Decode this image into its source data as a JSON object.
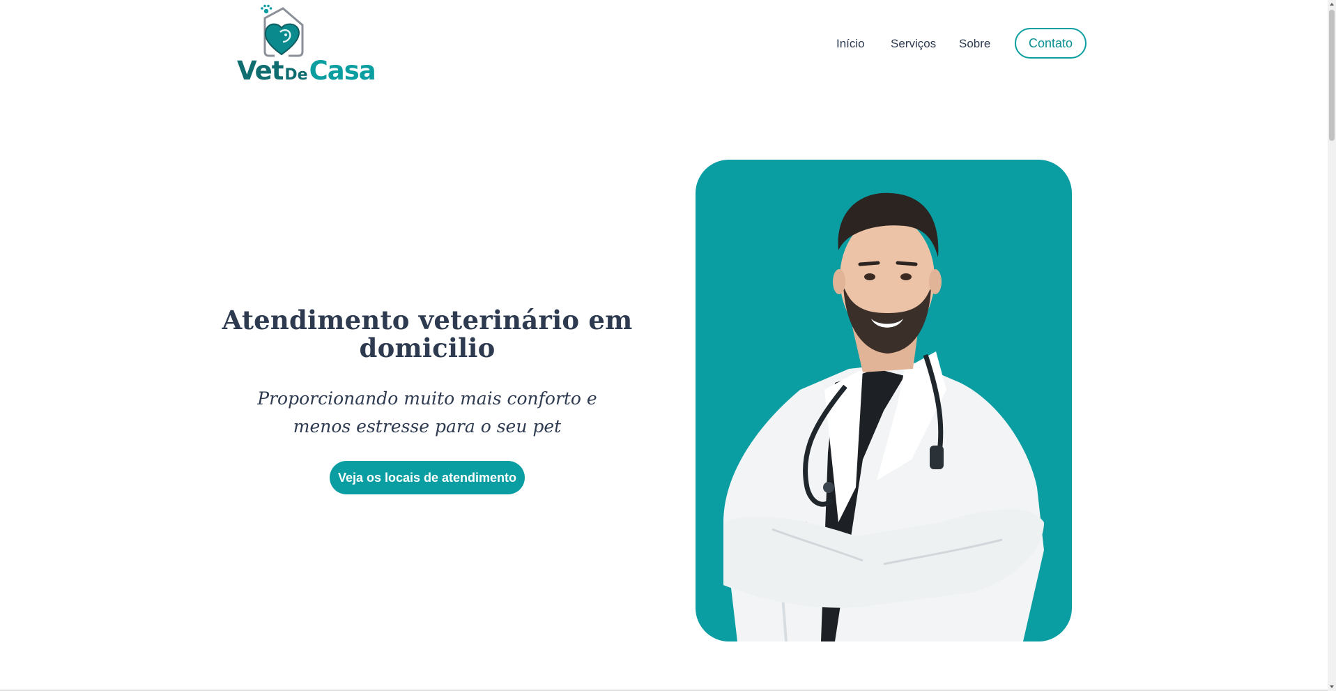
{
  "brand": {
    "name_part1": "Vet",
    "name_part2": "De",
    "name_part3": "Casa",
    "primary_color": "#0a9ea2",
    "dark_color": "#0f6d70",
    "text_color": "#2d3a4f"
  },
  "nav": {
    "items": [
      {
        "label": "Início"
      },
      {
        "label": "Serviços"
      },
      {
        "label": "Sobre"
      }
    ],
    "contact_label": "Contato"
  },
  "hero": {
    "title": "Atendimento veterinário em domicilio",
    "subtitle": "Proporcionando muito mais conforto e menos estresse para o seu pet",
    "cta_label": "Veja os locais de atendimento",
    "photo_icon": "veterinarian-photo"
  }
}
